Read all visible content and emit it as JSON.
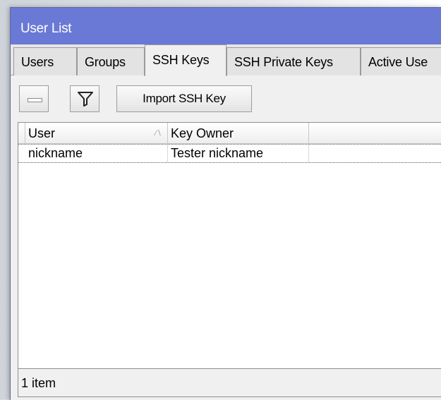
{
  "window": {
    "title": "User List"
  },
  "tabs": [
    {
      "label": "Users",
      "active": false
    },
    {
      "label": "Groups",
      "active": false
    },
    {
      "label": "SSH Keys",
      "active": true
    },
    {
      "label": "SSH Private Keys",
      "active": false
    },
    {
      "label": "Active Use",
      "active": false
    }
  ],
  "toolbar": {
    "remove_icon": "minus-icon",
    "filter_icon": "funnel-icon",
    "import_label": "Import SSH Key"
  },
  "table": {
    "columns": [
      "User",
      "Key Owner",
      ""
    ],
    "sorted_column": "User",
    "rows": [
      {
        "user": "nickname",
        "key_owner": "Tester nickname"
      }
    ]
  },
  "status": {
    "text": "1 item"
  }
}
